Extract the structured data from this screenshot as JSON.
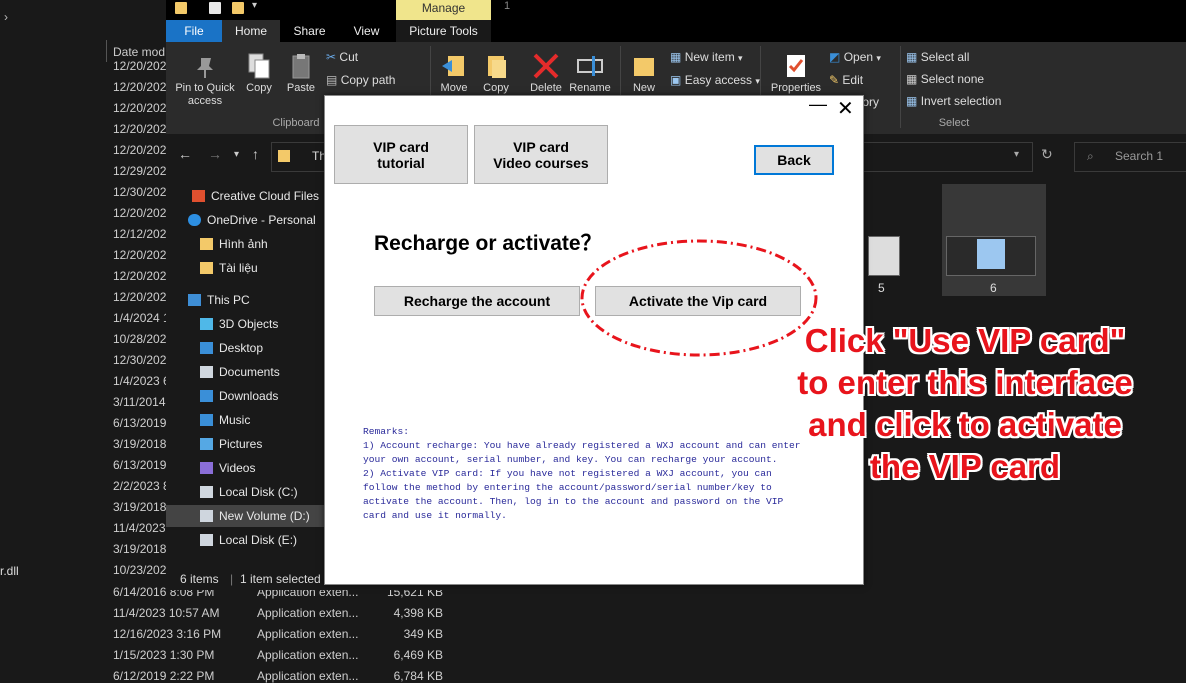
{
  "background_list": {
    "column_header": "Date mod",
    "left_file_fragment": "r.dll",
    "dates": [
      "12/20/202",
      "12/20/202",
      "12/20/202",
      "12/20/202",
      "12/20/202",
      "12/29/202",
      "12/30/202",
      "12/20/202",
      "12/12/202",
      "12/20/202",
      "12/20/202",
      "12/20/202",
      "1/4/2024 1",
      "10/28/202",
      "12/30/202",
      "1/4/2023 6",
      "3/11/2014",
      "6/13/2019",
      "3/19/2018",
      "6/13/2019",
      "2/2/2023 8",
      "3/19/2018",
      "11/4/2023",
      "3/19/2018",
      "10/23/202"
    ],
    "visible_rows": [
      {
        "date": "6/14/2016 8:08 PM",
        "type": "Application exten...",
        "size": "15,621 KB"
      },
      {
        "date": "11/4/2023 10:57 AM",
        "type": "Application exten...",
        "size": "4,398 KB"
      },
      {
        "date": "12/16/2023 3:16 PM",
        "type": "Application exten...",
        "size": "349 KB"
      },
      {
        "date": "1/15/2023 1:30 PM",
        "type": "Application exten...",
        "size": "6,469 KB"
      },
      {
        "date": "6/12/2019 2:22 PM",
        "type": "Application exten...",
        "size": "6,784 KB"
      }
    ]
  },
  "explorer": {
    "title_number": "1",
    "manage_tab": "Manage",
    "tabs": {
      "file": "File",
      "home": "Home",
      "share": "Share",
      "view": "View",
      "picture_tools": "Picture Tools"
    },
    "ribbon": {
      "pin": "Pin to Quick access",
      "copy": "Copy",
      "paste": "Paste",
      "cut": "Cut",
      "copy_path": "Copy path",
      "clipboard_group": "Clipboard",
      "move": "Move",
      "copy_to": "Copy",
      "delete": "Delete",
      "rename": "Rename",
      "new": "New",
      "new_item": "New item",
      "easy_access": "Easy access",
      "properties": "Properties",
      "open": "Open",
      "edit": "Edit",
      "history": "tory",
      "select_all": "Select all",
      "select_none": "Select none",
      "invert_selection": "Invert selection",
      "select_group": "Select"
    },
    "address_fragment": "Th",
    "search_placeholder": "Search 1",
    "nav": [
      {
        "label": "Creative Cloud Files",
        "icon": "creative-cloud-icon",
        "color": "#e0502f"
      },
      {
        "label": "OneDrive - Personal",
        "icon": "cloud-icon",
        "color": "#2d8fe2"
      },
      {
        "label": "Hình ảnh",
        "icon": "folder-icon",
        "color": "#f3c969"
      },
      {
        "label": "Tài liệu",
        "icon": "folder-icon",
        "color": "#f3c969"
      },
      {
        "label": "This PC",
        "icon": "computer-icon",
        "color": "#3e8ed6"
      },
      {
        "label": "3D Objects",
        "icon": "cube-icon",
        "color": "#4fb8e8"
      },
      {
        "label": "Desktop",
        "icon": "desktop-icon",
        "color": "#3a8fd8"
      },
      {
        "label": "Documents",
        "icon": "documents-icon",
        "color": "#cfd6de"
      },
      {
        "label": "Downloads",
        "icon": "download-icon",
        "color": "#3a8fd8"
      },
      {
        "label": "Music",
        "icon": "music-icon",
        "color": "#3a8fd8"
      },
      {
        "label": "Pictures",
        "icon": "pictures-icon",
        "color": "#55a8e4"
      },
      {
        "label": "Videos",
        "icon": "videos-icon",
        "color": "#8a6ed8"
      },
      {
        "label": "Local Disk (C:)",
        "icon": "drive-icon",
        "color": "#cfd6de"
      },
      {
        "label": "New Volume (D:)",
        "icon": "drive-icon",
        "color": "#cfd6de"
      },
      {
        "label": "Local Disk (E:)",
        "icon": "drive-icon",
        "color": "#cfd6de"
      }
    ],
    "thumbnails": [
      {
        "label": "5"
      },
      {
        "label": "6"
      }
    ],
    "status": {
      "items": "6 items",
      "selected": "1 item selected"
    }
  },
  "dialog": {
    "btn_vip_tutorial": "VIP card\ntutorial",
    "btn_vip_video": "VIP card\nVideo courses",
    "btn_back": "Back",
    "title": "Recharge or activate？",
    "btn_recharge": "Recharge the account",
    "btn_activate": "Activate the Vip card",
    "remarks": "Remarks:\n1) Account recharge: You have already registered a WXJ account and can enter\nyour own account, serial number, and key. You can recharge your account.\n2) Activate VIP card: If you have not registered a WXJ account, you can\nfollow the method by entering the account/password/serial number/key to\nactivate the account. Then, log in to the account and password on the VIP\ncard and use it normally.",
    "minimize": "—",
    "close": "✕"
  },
  "annotation": {
    "text": "Click \"Use VIP card\"\nto enter this interface\nand click to activate\nthe VIP card",
    "color": "#e8141c"
  }
}
